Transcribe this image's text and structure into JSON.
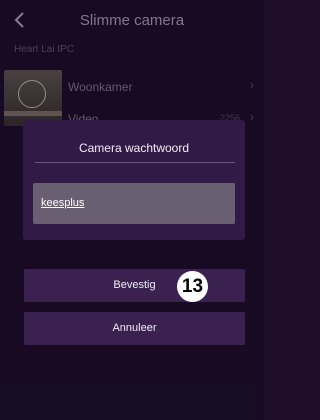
{
  "header": {
    "title": "Slimme camera",
    "back_icon": "chevron-left-icon"
  },
  "device": {
    "name": "Heart Lai IPC"
  },
  "camera_list": {
    "row_label": "Woonkamer",
    "sub_label": "Video",
    "sub_value": "2256",
    "chevron_icon": "chevron-right-icon"
  },
  "dialog": {
    "title": "Camera wachtwoord",
    "password_value": "keesplus",
    "confirm_label": "Bevestig",
    "cancel_label": "Annuleer"
  },
  "annotation": {
    "step_number": "13"
  },
  "colors": {
    "background": "#1d0d2a",
    "dialog": "#321a47",
    "field": "#6a5f72",
    "button": "#3a2150"
  }
}
